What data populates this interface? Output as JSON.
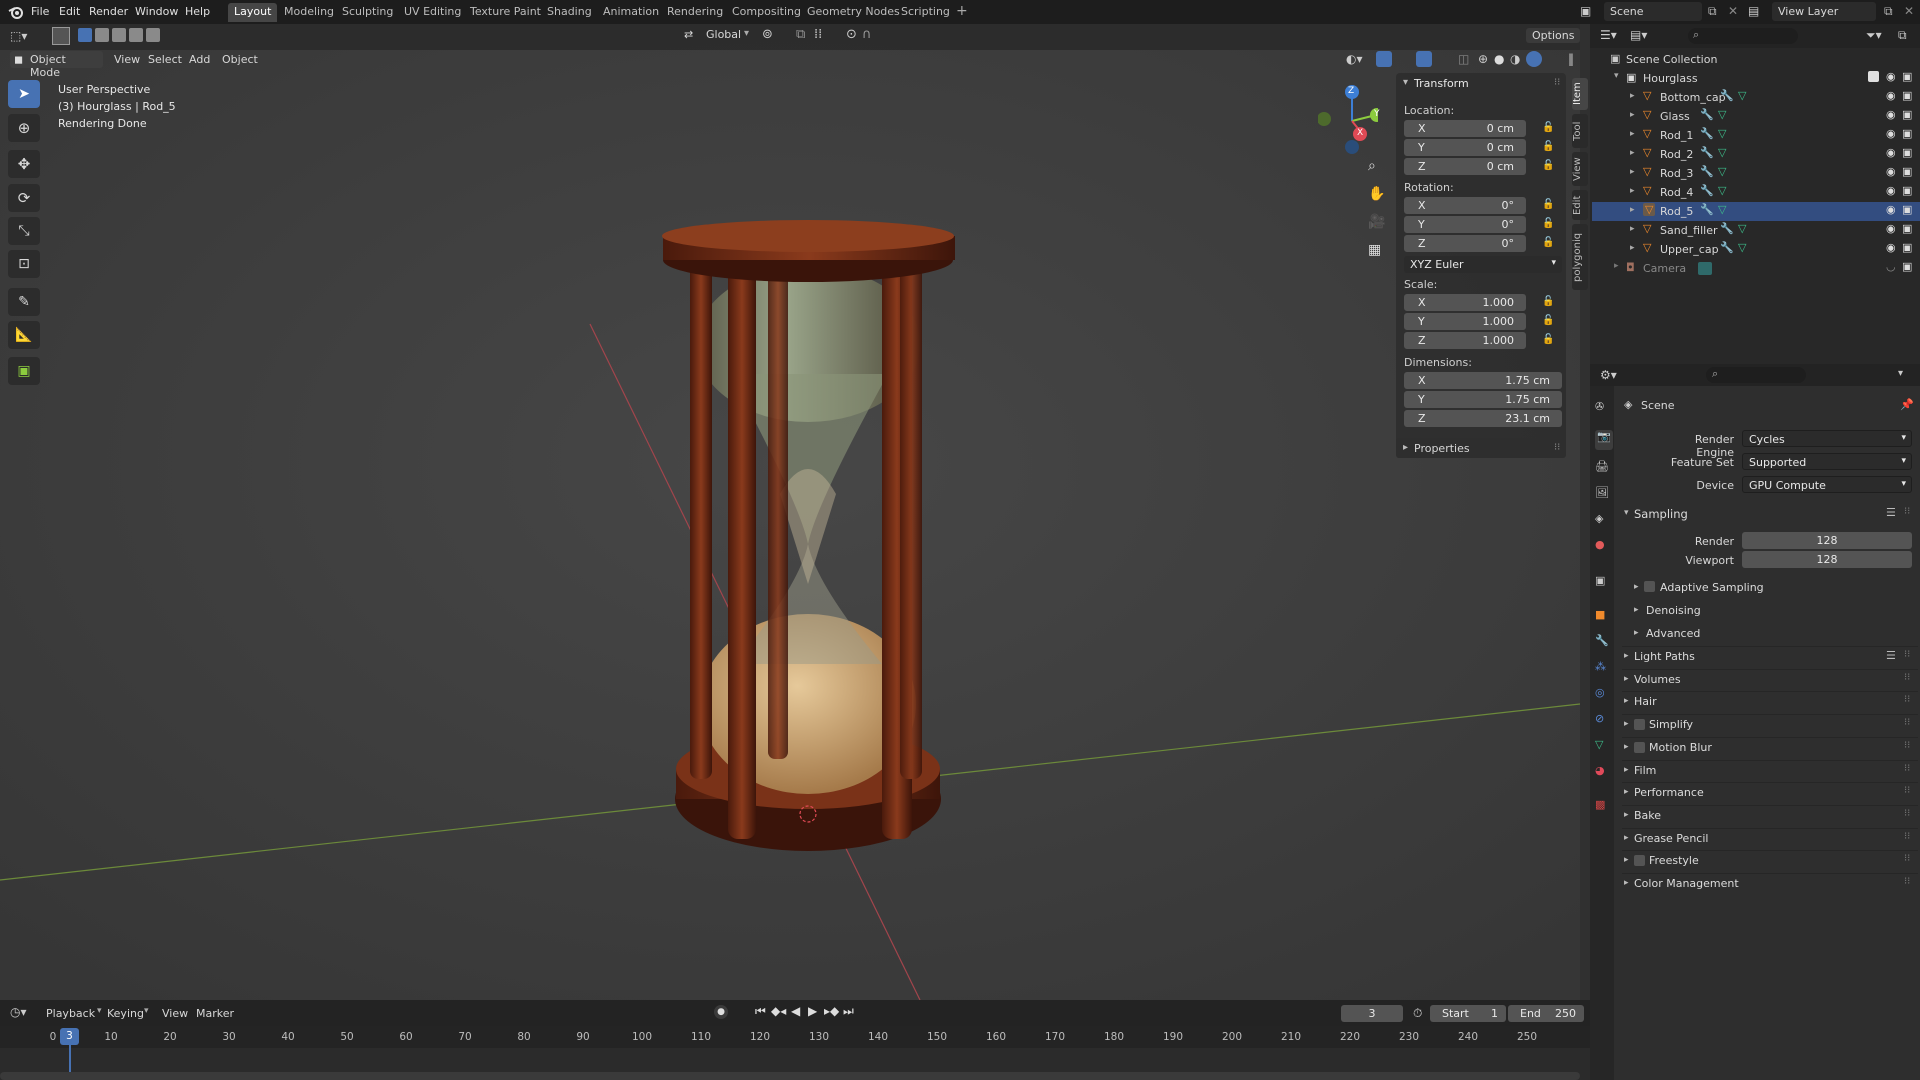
{
  "topbar": {
    "menus": [
      "File",
      "Edit",
      "Render",
      "Window",
      "Help"
    ],
    "workspaces": [
      "Layout",
      "Modeling",
      "Sculpting",
      "UV Editing",
      "Texture Paint",
      "Shading",
      "Animation",
      "Rendering",
      "Compositing",
      "Geometry Nodes",
      "Scripting"
    ],
    "active_workspace": "Layout",
    "scene": "Scene",
    "view_layer": "View Layer"
  },
  "viewport": {
    "mode": "Object Mode",
    "header_menus": [
      "View",
      "Select",
      "Add",
      "Object"
    ],
    "transform_orientation": "Global",
    "options_label": "Options",
    "info": {
      "line1": "User Perspective",
      "line2": "(3) Hourglass | Rod_5",
      "line3": "Rendering Done"
    },
    "gizmo_labels": {
      "z": "Z",
      "y": "Y",
      "x": "X"
    }
  },
  "n_panel": {
    "tabs": [
      "Item",
      "Tool",
      "View",
      "Edit",
      "polygoniq"
    ],
    "transform_title": "Transform",
    "location_label": "Location:",
    "location": [
      {
        "axis": "X",
        "value": "0 cm"
      },
      {
        "axis": "Y",
        "value": "0 cm"
      },
      {
        "axis": "Z",
        "value": "0 cm"
      }
    ],
    "rotation_label": "Rotation:",
    "rotation": [
      {
        "axis": "X",
        "value": "0°"
      },
      {
        "axis": "Y",
        "value": "0°"
      },
      {
        "axis": "Z",
        "value": "0°"
      }
    ],
    "rotation_mode": "XYZ Euler",
    "scale_label": "Scale:",
    "scale": [
      {
        "axis": "X",
        "value": "1.000"
      },
      {
        "axis": "Y",
        "value": "1.000"
      },
      {
        "axis": "Z",
        "value": "1.000"
      }
    ],
    "dimensions_label": "Dimensions:",
    "dimensions": [
      {
        "axis": "X",
        "value": "1.75 cm"
      },
      {
        "axis": "Y",
        "value": "1.75 cm"
      },
      {
        "axis": "Z",
        "value": "23.1 cm"
      }
    ],
    "properties_title": "Properties"
  },
  "outliner": {
    "root": "Scene Collection",
    "collection": "Hourglass",
    "objects": [
      "Bottom_cap",
      "Glass",
      "Rod_1",
      "Rod_2",
      "Rod_3",
      "Rod_4",
      "Rod_5",
      "Sand_filler",
      "Upper_cap"
    ],
    "selected": "Rod_5",
    "camera": "Camera"
  },
  "properties": {
    "context": "Scene",
    "render_engine_label": "Render Engine",
    "render_engine": "Cycles",
    "feature_set_label": "Feature Set",
    "feature_set": "Supported",
    "device_label": "Device",
    "device": "GPU Compute",
    "sampling_title": "Sampling",
    "render_label": "Render",
    "render_samples": "128",
    "viewport_label": "Viewport",
    "viewport_samples": "128",
    "sampling_sub": [
      "Adaptive Sampling",
      "Denoising",
      "Advanced"
    ],
    "panels": [
      "Light Paths",
      "Volumes",
      "Hair",
      "Simplify",
      "Motion Blur",
      "Film",
      "Performance",
      "Bake",
      "Grease Pencil",
      "Freestyle",
      "Color Management"
    ]
  },
  "timeline": {
    "menus": [
      "Playback",
      "Keying",
      "View",
      "Marker"
    ],
    "current_frame": "3",
    "start_label": "Start",
    "start": "1",
    "end_label": "End",
    "end": "250",
    "ticks": [
      "0",
      "10",
      "20",
      "30",
      "40",
      "50",
      "60",
      "70",
      "80",
      "90",
      "100",
      "110",
      "120",
      "130",
      "140",
      "150",
      "160",
      "170",
      "180",
      "190",
      "200",
      "210",
      "220",
      "230",
      "240",
      "250"
    ]
  },
  "colors": {
    "accent": "#4772b3",
    "axis_x": "#e04a55",
    "axis_y": "#8ccc3e",
    "axis_z": "#3d7fd6",
    "wood": "#6b2a14",
    "sand": "#c9a270"
  }
}
